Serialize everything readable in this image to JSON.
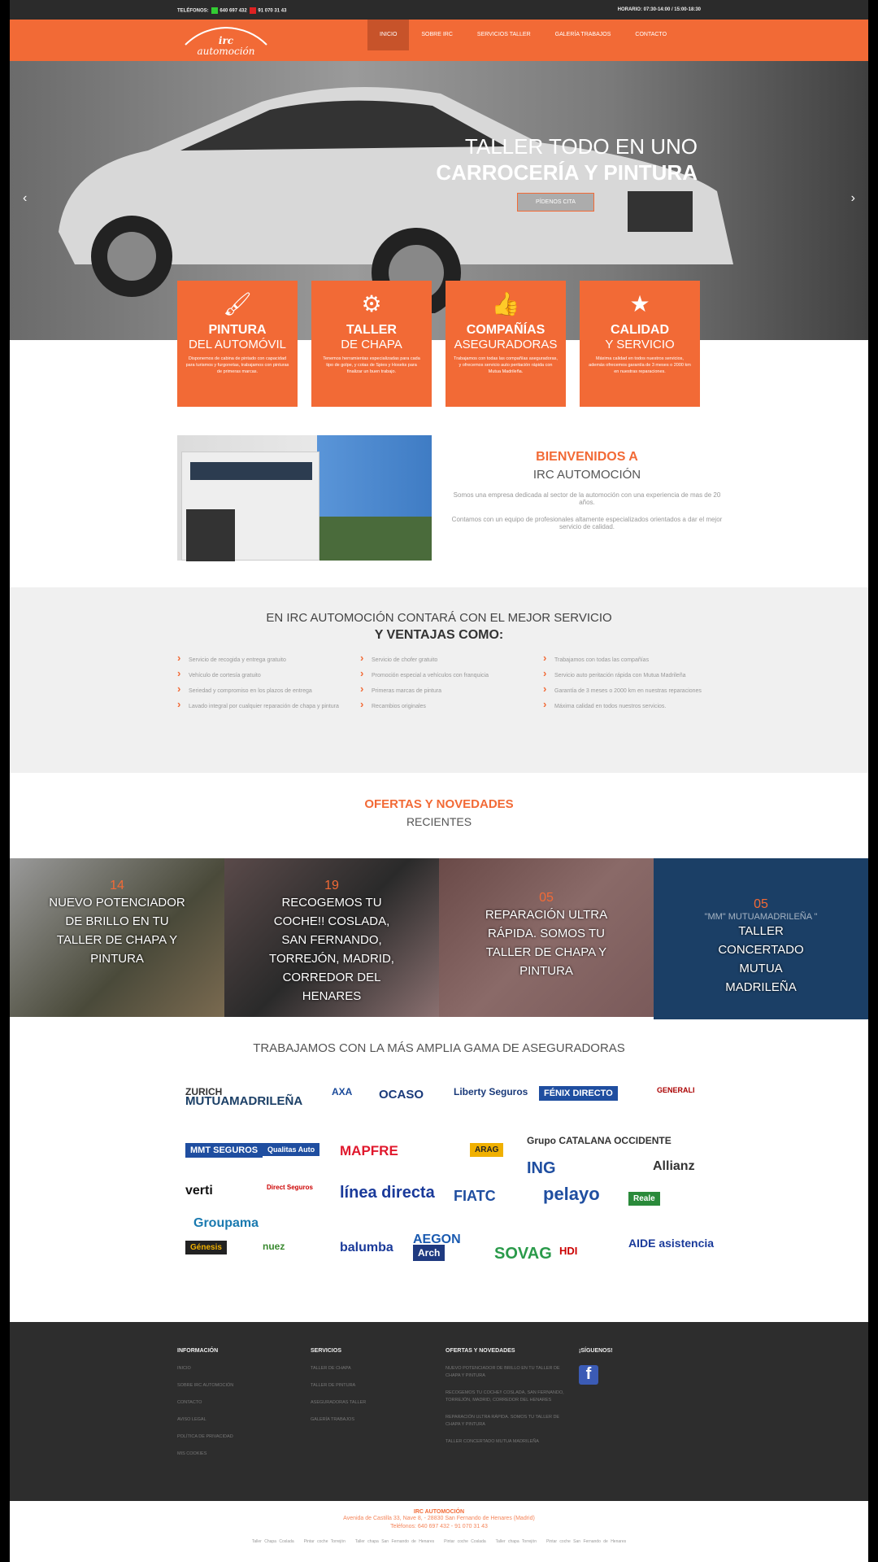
{
  "topbar": {
    "phones_label": "TELÉFONOS:",
    "phone_mobile": "640 697 432",
    "phone_land": "91 070 31 43",
    "schedule": "HORARIO: 07:30-14:00 / 15:00-18:30"
  },
  "brand": {
    "logo_text": "irc automoción"
  },
  "nav": [
    {
      "label": "INICIO",
      "active": true
    },
    {
      "label": "SOBRE IRC"
    },
    {
      "label": "SERVICIOS TALLER"
    },
    {
      "label": "GALERÍA TRABAJOS"
    },
    {
      "label": "CONTACTO"
    }
  ],
  "hero": {
    "line1": "TALLER TODO EN UNO",
    "line2": "CARROCERÍA Y PINTURA",
    "cta": "PÍDENOS CITA"
  },
  "features": [
    {
      "icon": "paint-brush-icon",
      "t1": "PINTURA",
      "t2": "DEL AUTOMÓVIL",
      "text": "Disponemos de cabina de pintado con capacidad para turismos y furgonetas, trabajamos con pinturas de primeras marcas."
    },
    {
      "icon": "gears-icon",
      "t1": "TALLER",
      "t2": "DE CHAPA",
      "text": "Tenemos herramientas especializadas para cada tipo de golpe, y cotas de Spies y Hoseks para finalizar un buen trabajo."
    },
    {
      "icon": "thumbs-up-icon",
      "t1": "COMPAÑÍAS",
      "t2": "ASEGURADORAS",
      "text": "Trabajamos con todas las compañías aseguradoras, y ofrecemos servicio auto peritación rápida con Mutua Madrileña."
    },
    {
      "icon": "star-icon",
      "t1": "CALIDAD",
      "t2": "Y SERVICIO",
      "text": "Máxima calidad en todos nuestros servicios, además ofrecemos garantía de 3 meses o 2000 km en nuestras reparaciones."
    }
  ],
  "welcome": {
    "title": "BIENVENIDOS A",
    "subtitle": "IRC AUTOMOCIÓN",
    "p1": "Somos una empresa dedicada al sector de la automoción con una experiencia de mas de 20 años.",
    "p2": "Contamos con un equipo de profesionales altamente especializados orientados a dar el mejor servicio de calidad."
  },
  "advantages": {
    "title": "EN IRC AUTOMOCIÓN CONTARÁ CON EL MEJOR SERVICIO",
    "subtitle": "Y VENTAJAS COMO:",
    "cols": [
      [
        "Servicio de recogida y entrega gratuito",
        "Vehículo de cortesía gratuito",
        "Seriedad y compromiso en los plazos de entrega",
        "Lavado integral por cualquier reparación de chapa y pintura"
      ],
      [
        "Servicio de chofer gratuito",
        "Promoción especial a vehículos con franquicia",
        "Primeras marcas de pintura",
        "Recambios originales"
      ],
      [
        "Trabajamos con todas las compañías",
        "Servicio auto peritación rápida con Mutua Madrileña",
        "Garantía de 3 meses o 2000 km en nuestras reparaciones",
        "Máxima calidad en todos nuestros servicios."
      ]
    ]
  },
  "offers": {
    "title": "OFERTAS Y NOVEDADES",
    "subtitle": "RECIENTES",
    "items": [
      {
        "date": "14",
        "title": "NUEVO POTENCIADOR DE BRILLO EN TU TALLER DE CHAPA Y PINTURA"
      },
      {
        "date": "19",
        "title": "RECOGEMOS TU COCHE!! COSLADA, SAN FERNANDO, TORREJÓN, MADRID, CORREDOR DEL HENARES"
      },
      {
        "date": "05",
        "title": "REPARACIÓN ULTRA RÁPIDA. SOMOS TU TALLER DE CHAPA Y PINTURA"
      },
      {
        "date": "05",
        "title": "TALLER CONCERTADO MUTUA MADRILEÑA",
        "logo": "\"MM\" MUTUAMADRILEÑA \""
      }
    ]
  },
  "insurers": {
    "title": "TRABAJAMOS CON LA MÁS AMPLIA GAMA DE ASEGURADORAS",
    "logos": [
      "MUTUAMADRILEÑA",
      "AXA",
      "OCASO",
      "Liberty Seguros",
      "FÉNIX DIRECTO",
      "GENERALI",
      "MMT SEGUROS",
      "Qualitas Auto",
      "MAPFRE",
      "ARAG",
      "Grupo CATALANA OCCIDENTE",
      "ING",
      "Allianz",
      "verti",
      "Direct Seguros",
      "línea directa",
      "FIATC",
      "pelayo",
      "Reale",
      "Groupama",
      "Génesis",
      "nuez",
      "balumba",
      "AEGON",
      "Arch",
      "SOVAG",
      "HDI",
      "AIDE asistencia",
      "ZURICH"
    ]
  },
  "footer": {
    "cols": [
      {
        "title": "INFORMACIÓN",
        "items": [
          "INICIO",
          "SOBRE IRC AUTOMOCIÓN",
          "CONTACTO",
          "AVISO LEGAL",
          "POLÍTICA DE PRIVACIDAD",
          "MIS COOKIES"
        ]
      },
      {
        "title": "SERVICIOS",
        "items": [
          "TALLER DE CHAPA",
          "TALLER DE PINTURA",
          "ASEGURADORAS TALLER",
          "GALERÍA TRABAJOS"
        ]
      },
      {
        "title": "OFERTAS Y NOVEDADES",
        "items": [
          "NUEVO POTENCIADOR DE BRILLO EN TU TALLER DE CHAPA Y PINTURA",
          "RECOGEMOS TU COCHE!! COSLADA, SAN FERNANDO, TORREJÓN, MADRID, CORREDOR DEL HENARES",
          "REPARACIÓN ULTRA RÁPIDA. SOMOS TU TALLER DE CHAPA Y PINTURA",
          "TALLER CONCERTADO MUTUA MADRILEÑA"
        ]
      },
      {
        "title": "¡SÍGUENOS!"
      }
    ]
  },
  "bottom": {
    "name": "IRC AUTOMOCIÓN",
    "address": "Avenida de Castilla 33, Nave 8, - 28830 San Fernando de Henares (Madrid)",
    "phones": "Teléfonos: 640 697 432 - 91 070 31 43",
    "links": [
      "Taller Chapa Coslada",
      "Pintar coche Torrejón",
      "Taller chapa San Fernando de Henares",
      "Pintar coche Coslada",
      "Taller chapa Torrejón",
      "Pintar coche San Fernando de Henares"
    ]
  },
  "colors": {
    "accent": "#f26a36",
    "dark": "#2d2d2d",
    "mutua_blue": "#1b3f66"
  }
}
